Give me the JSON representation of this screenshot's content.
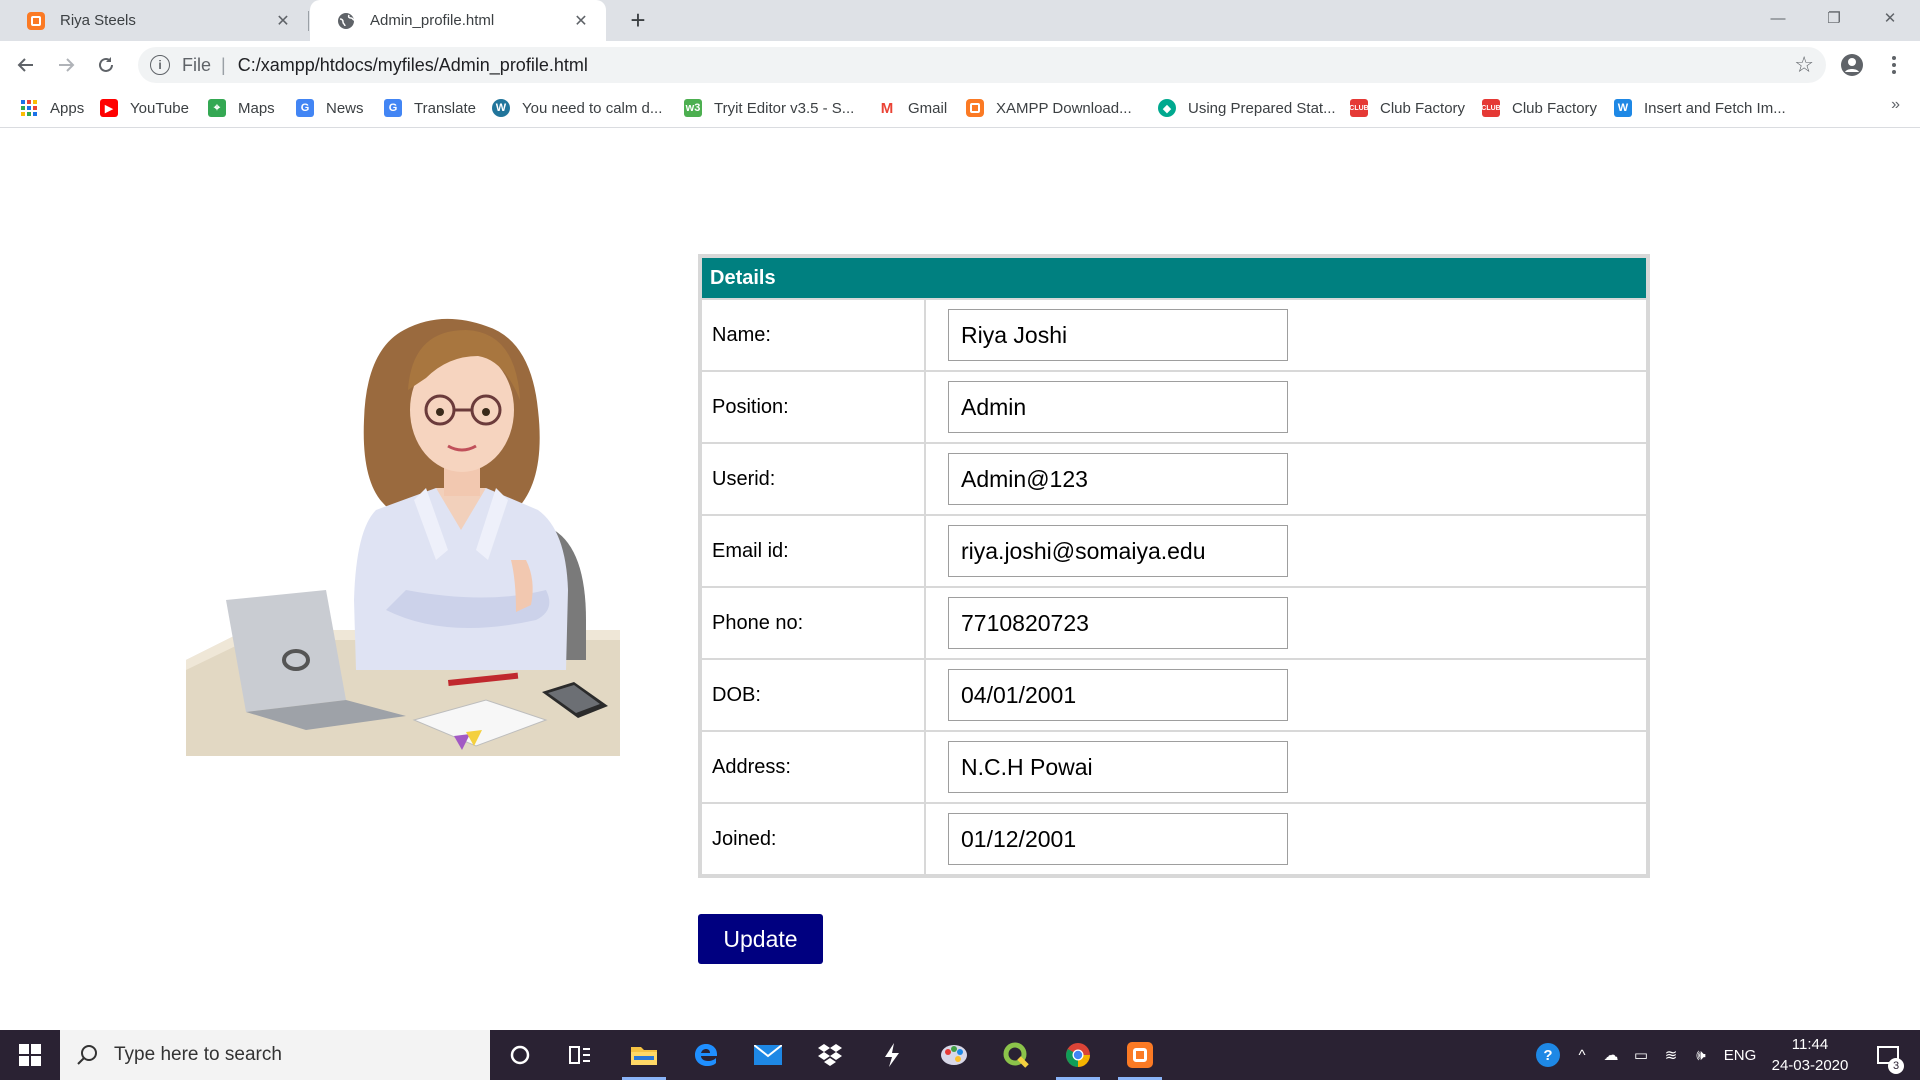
{
  "browser": {
    "tabs": [
      {
        "title": "Riya Steels",
        "icon": "xampp-icon",
        "active": false
      },
      {
        "title": "Admin_profile.html",
        "icon": "globe-icon",
        "active": true
      }
    ],
    "address": {
      "scheme": "File",
      "url": "C:/xampp/htdocs/myfiles/Admin_profile.html"
    },
    "bookmarks": [
      {
        "label": "Apps",
        "icon": "apps-grid-icon"
      },
      {
        "label": "YouTube",
        "icon": "youtube-icon"
      },
      {
        "label": "Maps",
        "icon": "maps-icon"
      },
      {
        "label": "News",
        "icon": "news-icon"
      },
      {
        "label": "Translate",
        "icon": "translate-icon"
      },
      {
        "label": "You need to calm d...",
        "icon": "wordpress-icon"
      },
      {
        "label": "Tryit Editor v3.5 - S...",
        "icon": "w3schools-icon"
      },
      {
        "label": "Gmail",
        "icon": "gmail-icon"
      },
      {
        "label": "XAMPP Download...",
        "icon": "xampp-icon"
      },
      {
        "label": "Using Prepared Stat...",
        "icon": "shield-icon"
      },
      {
        "label": "Club Factory",
        "icon": "clubfactory-icon"
      },
      {
        "label": "Club Factory",
        "icon": "clubfactory-icon"
      },
      {
        "label": "Insert and Fetch Im...",
        "icon": "w-icon"
      }
    ]
  },
  "page": {
    "table_header": "Details",
    "fields": [
      {
        "label": "Name:",
        "value": "Riya Joshi"
      },
      {
        "label": "Position:",
        "value": "Admin"
      },
      {
        "label": "Userid:",
        "value": "Admin@123"
      },
      {
        "label": "Email id:",
        "value": "riya.joshi@somaiya.edu"
      },
      {
        "label": "Phone no:",
        "value": "7710820723"
      },
      {
        "label": "DOB:",
        "value": "04/01/2001"
      },
      {
        "label": "Address:",
        "value": "N.C.H Powai"
      },
      {
        "label": "Joined:",
        "value": "01/12/2001"
      }
    ],
    "update_label": "Update"
  },
  "taskbar": {
    "search_placeholder": "Type here to search",
    "language": "ENG",
    "time": "11:44",
    "date": "24-03-2020",
    "notifications": "3"
  },
  "colors": {
    "header_teal": "#008080",
    "button_navy": "#000080",
    "taskbar": "#2a2233"
  }
}
